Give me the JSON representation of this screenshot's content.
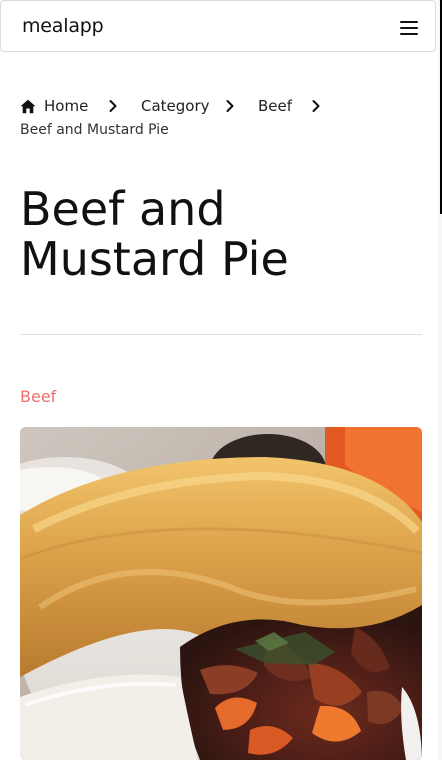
{
  "navbar": {
    "brand": "mealapp",
    "menu_icon": "hamburger-menu-icon"
  },
  "breadcrumb": {
    "home_icon": "home-icon",
    "separator_icon": "chevron-right-icon",
    "items": [
      {
        "label": "Home"
      },
      {
        "label": "Category"
      },
      {
        "label": "Beef"
      }
    ],
    "current": "Beef and Mustard Pie"
  },
  "page": {
    "title": "Beef and Mustard Pie",
    "category": "Beef"
  },
  "colors": {
    "accent": "#ef6f6c"
  }
}
